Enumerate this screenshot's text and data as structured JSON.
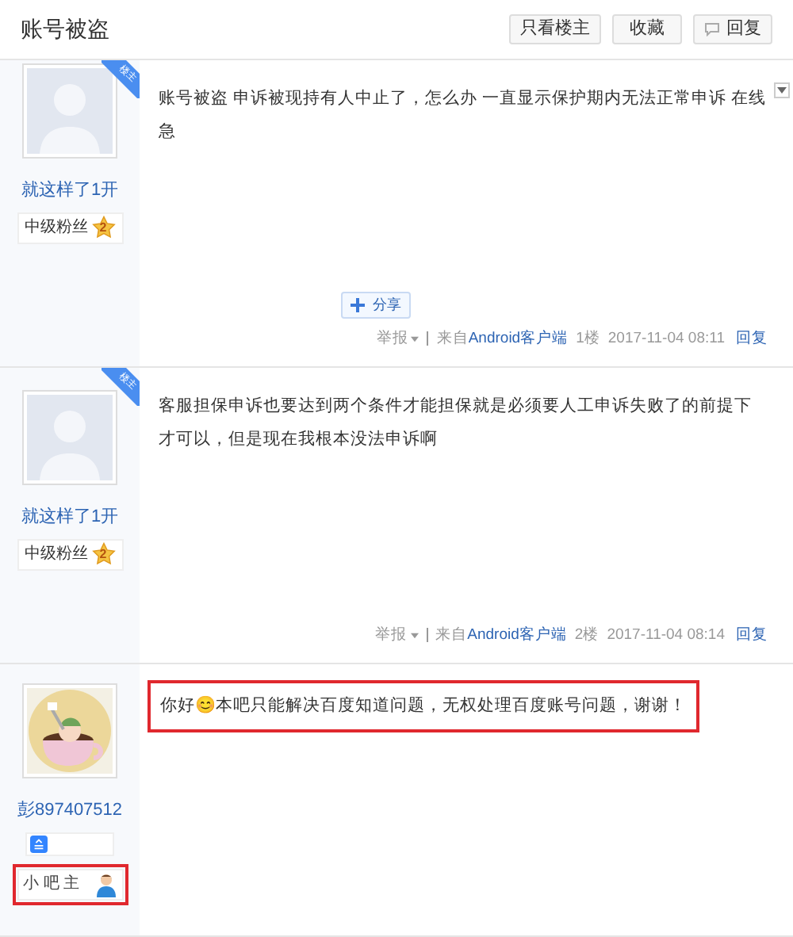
{
  "header": {
    "title": "账号被盗",
    "buttons": [
      {
        "label": "只看楼主",
        "icon": false
      },
      {
        "label": "收藏",
        "icon": false
      },
      {
        "label": "回复",
        "icon": true
      }
    ]
  },
  "posts": [
    {
      "author": "就这样了1开",
      "is_op": true,
      "op_label": "楼主",
      "avatar": {
        "kind": "default"
      },
      "badges": [
        {
          "kind": "level",
          "label": "中级粉丝",
          "level_number": "2",
          "highlighted": false
        }
      ],
      "content": [
        "账号被盗 申诉被现持有人中止了，怎么办 一直显示保护期内无法正常申诉 在线急"
      ],
      "content_highlighted": false,
      "share": "分享",
      "menu_toggle": true,
      "footer": {
        "report": "举报",
        "source_prefix": "来自",
        "source": "Android客户端",
        "floor": "1楼",
        "time": "2017-11-04 08:11",
        "reply": "回复"
      }
    },
    {
      "author": "就这样了1开",
      "is_op": true,
      "op_label": "楼主",
      "avatar": {
        "kind": "default"
      },
      "badges": [
        {
          "kind": "level",
          "label": "中级粉丝",
          "level_number": "2",
          "highlighted": false
        }
      ],
      "content": [
        "客服担保申诉也要达到两个条件才能担保就是必须要人工申诉失败了的前提下才可以，但是现在我根本没法申诉啊"
      ],
      "content_highlighted": false,
      "menu_toggle": false,
      "footer": {
        "report": "举报",
        "source_prefix": "来自",
        "source": "Android客户端",
        "floor": "2楼",
        "time": "2017-11-04 08:14",
        "reply": "回复"
      }
    },
    {
      "author": "彭897407512",
      "is_op": false,
      "avatar": {
        "kind": "picture"
      },
      "badges": [
        {
          "kind": "icon",
          "highlighted": false
        },
        {
          "kind": "role",
          "label": "小 吧 主",
          "highlighted": true
        }
      ],
      "content": [
        "你好😊本吧只能解决百度知道问题，无权处理百度账号问题，谢谢！"
      ],
      "content_highlighted": true,
      "menu_toggle": false
    }
  ]
}
